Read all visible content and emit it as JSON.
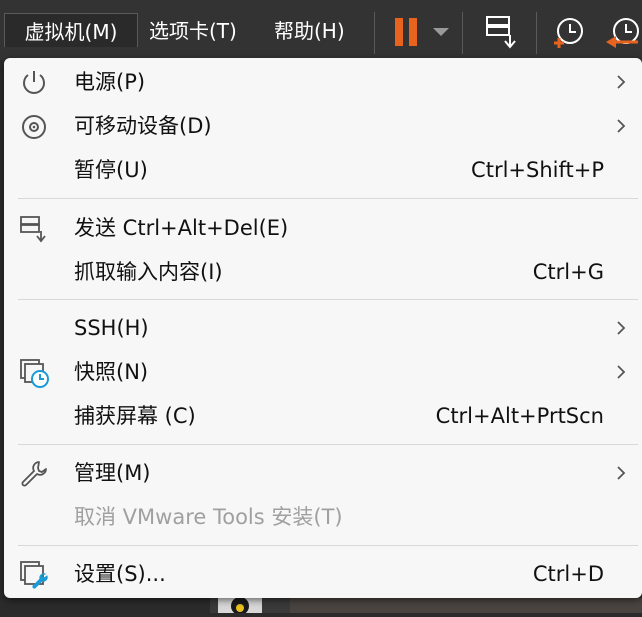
{
  "menubar": {
    "menus": [
      {
        "label": "虚拟机(M)"
      },
      {
        "label": "选项卡(T)"
      },
      {
        "label": "帮助(H)"
      }
    ]
  },
  "toolbar": {
    "icons": [
      "pause-icon",
      "dropdown-arrow-icon",
      "send-ctrl-alt-del-icon",
      "snapshot-icon",
      "revert-snapshot-icon"
    ],
    "pause_color": "#e8641e"
  },
  "vm_menu": {
    "items": [
      {
        "label": "电源(P)",
        "shortcut": "",
        "icon": "power-icon",
        "submenu": true
      },
      {
        "label": "可移动设备(D)",
        "shortcut": "",
        "icon": "removable-device-icon",
        "submenu": true
      },
      {
        "label": "暂停(U)",
        "shortcut": "Ctrl+Shift+P",
        "icon": "",
        "submenu": false
      },
      {
        "label": "发送 Ctrl+Alt+Del(E)",
        "shortcut": "",
        "icon": "send-ctrl-alt-del-icon",
        "submenu": false
      },
      {
        "label": "抓取输入内容(I)",
        "shortcut": "Ctrl+G",
        "icon": "",
        "submenu": false
      },
      {
        "label": "SSH(H)",
        "shortcut": "",
        "icon": "",
        "submenu": true
      },
      {
        "label": "快照(N)",
        "shortcut": "",
        "icon": "snapshot-icon",
        "submenu": true
      },
      {
        "label": "捕获屏幕 (C)",
        "shortcut": "Ctrl+Alt+PrtScn",
        "icon": "",
        "submenu": false
      },
      {
        "label": "管理(M)",
        "shortcut": "",
        "icon": "wrench-icon",
        "submenu": true
      },
      {
        "label": "取消 VMware Tools 安装(T)",
        "shortcut": "",
        "icon": "",
        "submenu": false,
        "disabled": true
      },
      {
        "label": "设置(S)...",
        "shortcut": "Ctrl+D",
        "icon": "settings-icon",
        "submenu": false
      }
    ]
  },
  "colors": {
    "accent_orange": "#e8641e",
    "accent_blue": "#1a9ad6"
  }
}
